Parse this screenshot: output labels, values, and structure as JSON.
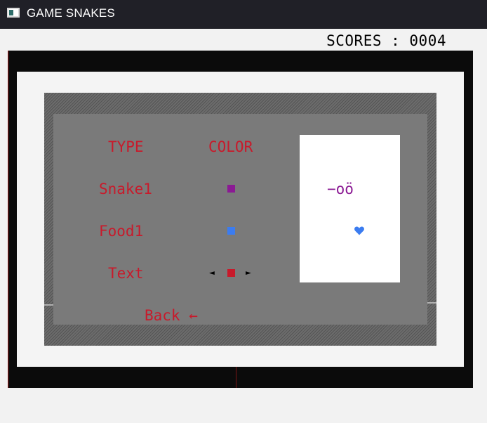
{
  "window": {
    "title": "GAME SNAKES"
  },
  "scores": {
    "text": "SCORES : 0004"
  },
  "settings": {
    "header_type": "TYPE",
    "header_color": "COLOR",
    "rows": [
      {
        "type": "Snake1",
        "color": "#8b1a94"
      },
      {
        "type": "Food1",
        "color": "#3b7cf0"
      },
      {
        "type": "Text",
        "color": "#c81a2b"
      }
    ],
    "prev_arrow": "◄",
    "next_arrow": "►",
    "back_label": "Back ←"
  },
  "preview": {
    "snake_text": "−oö",
    "food_icon": "heart-icon",
    "food_color": "#3b7cf0"
  },
  "colors": {
    "text": "#c81a2b",
    "panel": "#7a7a7a",
    "board": "#0b0b0b",
    "titlebar": "#202027"
  }
}
